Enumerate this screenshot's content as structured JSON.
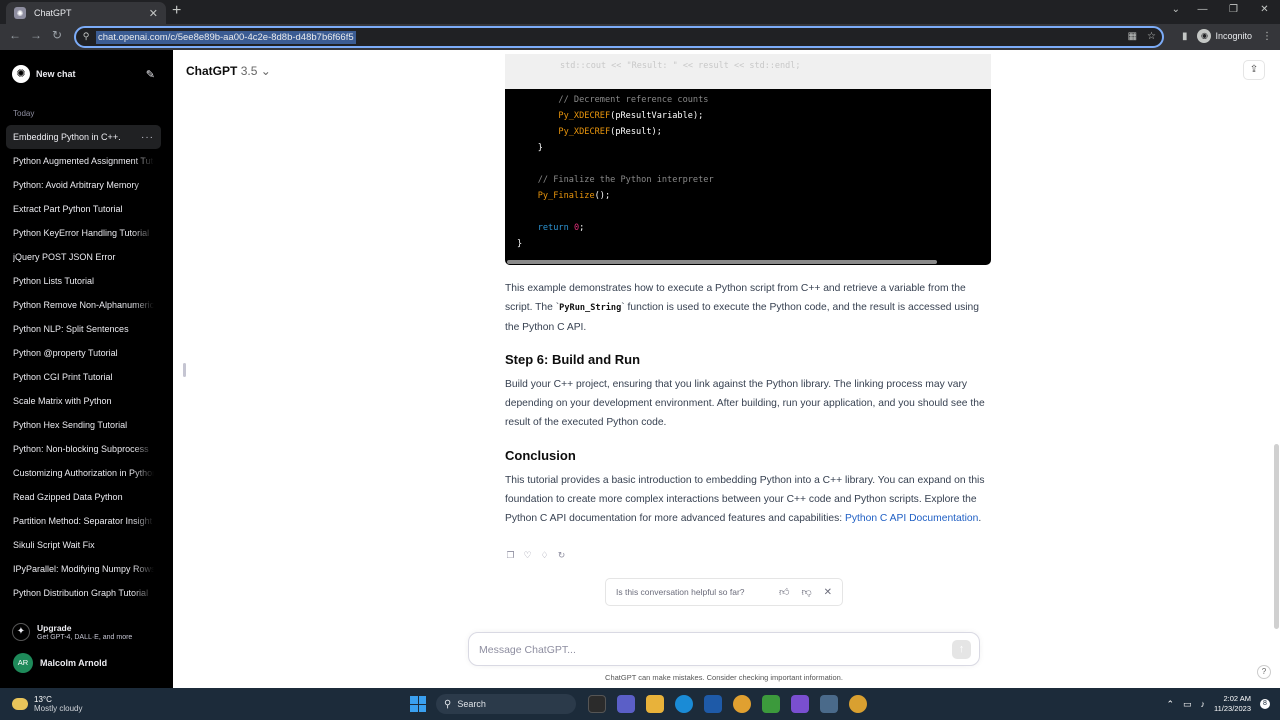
{
  "browser": {
    "tab_title": "ChatGPT",
    "url": "chat.openai.com/c/5ee8e89b-aa00-4c2e-8d8b-d48b7b6f66f5",
    "incognito_label": "Incognito"
  },
  "sidebar": {
    "new_chat": "New chat",
    "section": "Today",
    "items": [
      "Embedding Python in C++.",
      "Python Augmented Assignment Tutorial",
      "Python: Avoid Arbitrary Memory",
      "Extract Part Python Tutorial",
      "Python KeyError Handling Tutorial",
      "jQuery POST JSON Error",
      "Python Lists Tutorial",
      "Python Remove Non-Alphanumeric",
      "Python NLP: Split Sentences",
      "Python @property Tutorial",
      "Python CGI Print Tutorial",
      "Scale Matrix with Python",
      "Python Hex Sending Tutorial",
      "Python: Non-blocking Subprocess",
      "Customizing Authorization in Python",
      "Read Gzipped Data Python",
      "Partition Method: Separator Insight",
      "Sikuli Script Wait Fix",
      "IPyParallel: Modifying Numpy Rows",
      "Python Distribution Graph Tutorial"
    ],
    "upgrade_title": "Upgrade",
    "upgrade_sub": "Get GPT-4, DALL·E, and more",
    "user_initials": "AR",
    "user_name": "Malcolm Arnold"
  },
  "header": {
    "model_name": "ChatGPT",
    "model_version": "3.5"
  },
  "code": {
    "top_line": "std::cout << \"Result: \" << result << std::endl;",
    "lines": [
      {
        "indent": "        ",
        "parts": [
          {
            "t": "// Decrement reference counts",
            "c": "comment"
          }
        ]
      },
      {
        "indent": "        ",
        "parts": [
          {
            "t": "Py_XDECREF",
            "c": "fn"
          },
          {
            "t": "(pResultVariable);",
            "c": ""
          }
        ]
      },
      {
        "indent": "        ",
        "parts": [
          {
            "t": "Py_XDECREF",
            "c": "fn"
          },
          {
            "t": "(pResult);",
            "c": ""
          }
        ]
      },
      {
        "indent": "    ",
        "parts": [
          {
            "t": "}",
            "c": ""
          }
        ]
      },
      {
        "indent": "",
        "parts": []
      },
      {
        "indent": "    ",
        "parts": [
          {
            "t": "// Finalize the Python interpreter",
            "c": "comment"
          }
        ]
      },
      {
        "indent": "    ",
        "parts": [
          {
            "t": "Py_Finalize",
            "c": "fn"
          },
          {
            "t": "();",
            "c": ""
          }
        ]
      },
      {
        "indent": "",
        "parts": []
      },
      {
        "indent": "    ",
        "parts": [
          {
            "t": "return",
            "c": "kw"
          },
          {
            "t": " ",
            "c": ""
          },
          {
            "t": "0",
            "c": "num"
          },
          {
            "t": ";",
            "c": ""
          }
        ]
      },
      {
        "indent": "",
        "parts": [
          {
            "t": "}",
            "c": ""
          }
        ]
      }
    ]
  },
  "content": {
    "p1_a": "This example demonstrates how to execute a Python script from C++ and retrieve a variable from the script. The `",
    "p1_code": "PyRun_String",
    "p1_b": "` function is used to execute the Python code, and the result is accessed using the Python C API.",
    "h_step6": "Step 6: Build and Run",
    "p2": "Build your C++ project, ensuring that you link against the Python library. The linking process may vary depending on your development environment. After building, run your application, and you should see the result of the executed Python code.",
    "h_conclusion": "Conclusion",
    "p3": "This tutorial provides a basic introduction to embedding Python into a C++ library. You can expand on this foundation to create more complex interactions between your C++ code and Python scripts. Explore the Python C API documentation for more advanced features and capabilities: ",
    "p3_link": "Python C API Documentation",
    "p3_end": "."
  },
  "feedback": {
    "question": "Is this conversation helpful so far?"
  },
  "composer": {
    "placeholder": "Message ChatGPT...",
    "disclaimer": "ChatGPT can make mistakes. Consider checking important information."
  },
  "taskbar": {
    "temp": "13°C",
    "weather": "Mostly cloudy",
    "search": "Search",
    "time": "2:02 AM",
    "date": "11/23/2023",
    "notif_count": "8"
  }
}
